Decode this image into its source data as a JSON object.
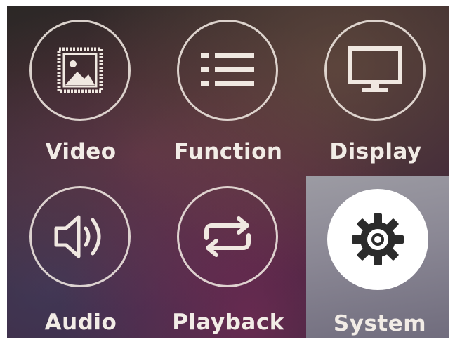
{
  "menu": {
    "items": [
      {
        "label": "Video",
        "icon": "picture-icon",
        "selected": false
      },
      {
        "label": "Function",
        "icon": "list-icon",
        "selected": false
      },
      {
        "label": "Display",
        "icon": "monitor-icon",
        "selected": false
      },
      {
        "label": "Audio",
        "icon": "speaker-icon",
        "selected": false
      },
      {
        "label": "Playback",
        "icon": "repeat-icon",
        "selected": false
      },
      {
        "label": "System",
        "icon": "gear-icon",
        "selected": true
      }
    ]
  },
  "colors": {
    "icon_stroke": "#f0e8e1",
    "selected_tile": "#8a8794",
    "selected_icon": "#2b2b2b",
    "label_text": "#f2ece6"
  }
}
